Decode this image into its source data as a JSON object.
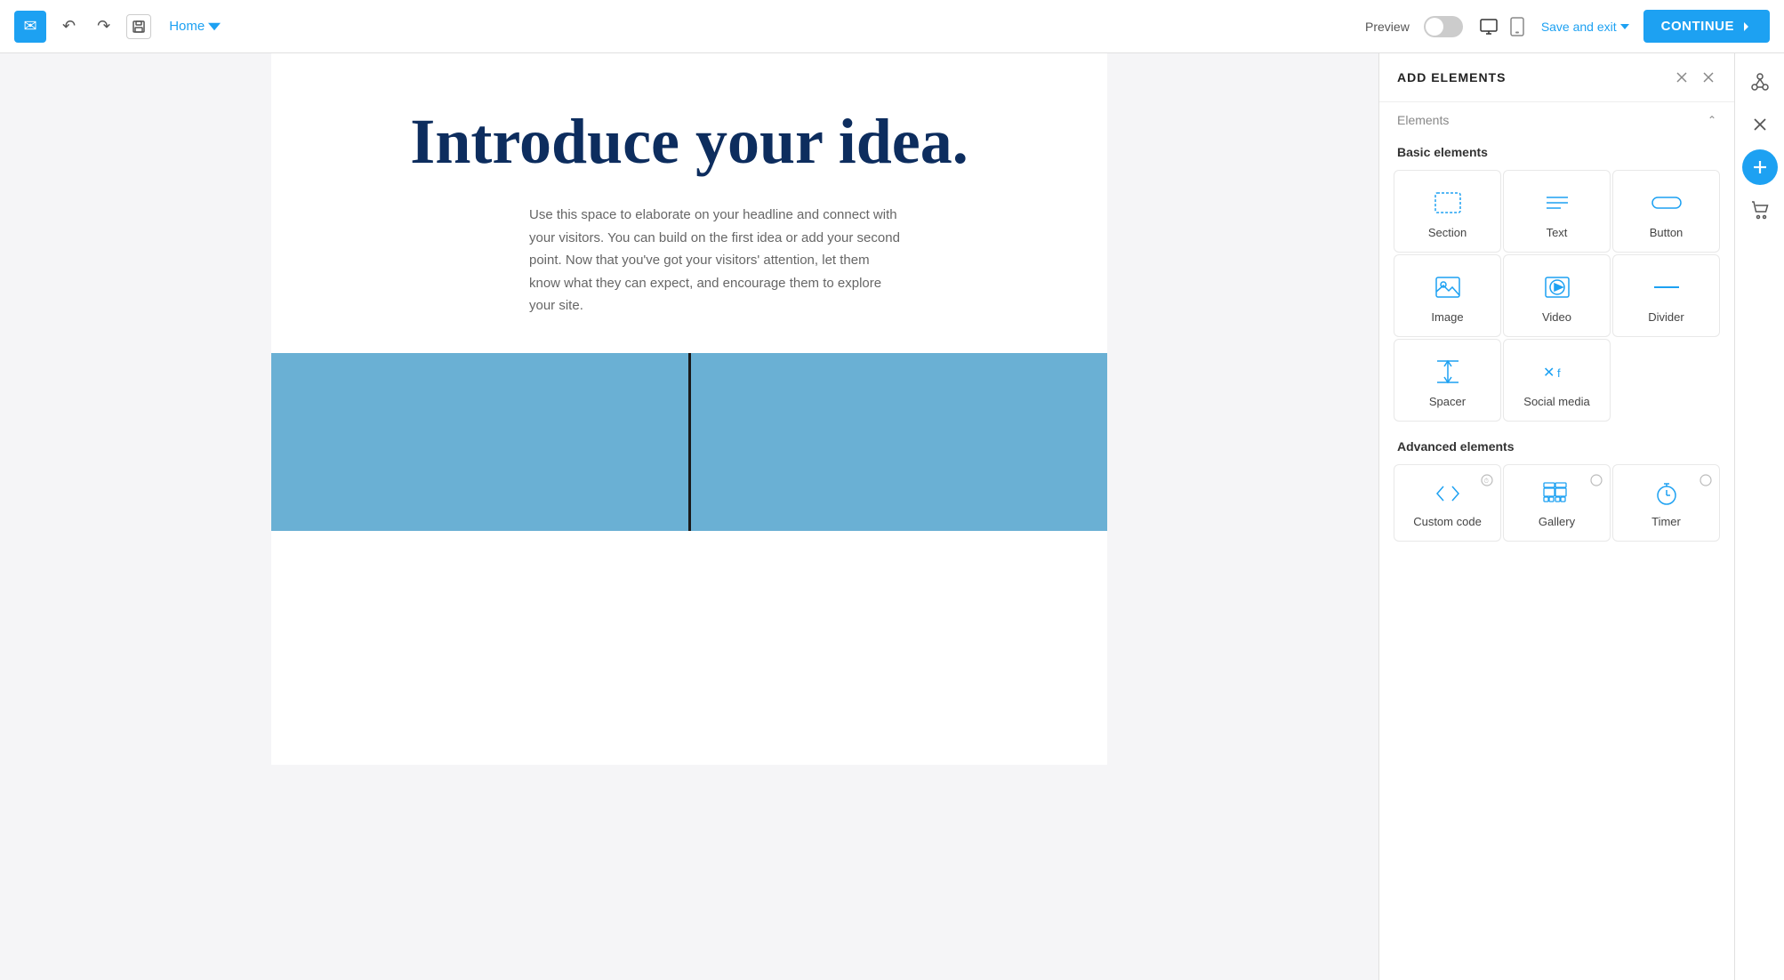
{
  "navbar": {
    "home_label": "Home",
    "preview_label": "Preview",
    "save_exit_label": "Save and exit",
    "continue_label": "CONTINUE",
    "toggle_on": false
  },
  "canvas": {
    "hero_title": "Introduce your idea.",
    "hero_body": "Use this space to elaborate on your headline and connect with your visitors. You can build on the first idea or add your second point. Now that you've got your visitors' attention, let them know what they can expect, and encourage them to explore your site."
  },
  "add_elements_panel": {
    "title": "ADD ELEMENTS",
    "elements_section_label": "Elements",
    "basic_elements_label": "Basic elements",
    "items": [
      {
        "id": "section",
        "label": "Section",
        "icon": "section"
      },
      {
        "id": "text",
        "label": "Text",
        "icon": "text"
      },
      {
        "id": "button",
        "label": "Button",
        "icon": "button"
      },
      {
        "id": "image",
        "label": "Image",
        "icon": "image"
      },
      {
        "id": "video",
        "label": "Video",
        "icon": "video"
      },
      {
        "id": "divider",
        "label": "Divider",
        "icon": "divider"
      },
      {
        "id": "spacer",
        "label": "Spacer",
        "icon": "spacer"
      },
      {
        "id": "social-media",
        "label": "Social media",
        "icon": "social"
      }
    ],
    "advanced_elements_label": "Advanced elements",
    "advanced_items": [
      {
        "id": "custom-code",
        "label": "Custom code",
        "icon": "code"
      },
      {
        "id": "gallery",
        "label": "Gallery",
        "icon": "gallery"
      },
      {
        "id": "timer",
        "label": "Timer",
        "icon": "timer"
      }
    ]
  },
  "sidebar": {
    "network_icon_label": "network-icon",
    "close_icon_label": "close-icon",
    "add_icon_label": "add-icon",
    "cart_icon_label": "cart-icon"
  }
}
